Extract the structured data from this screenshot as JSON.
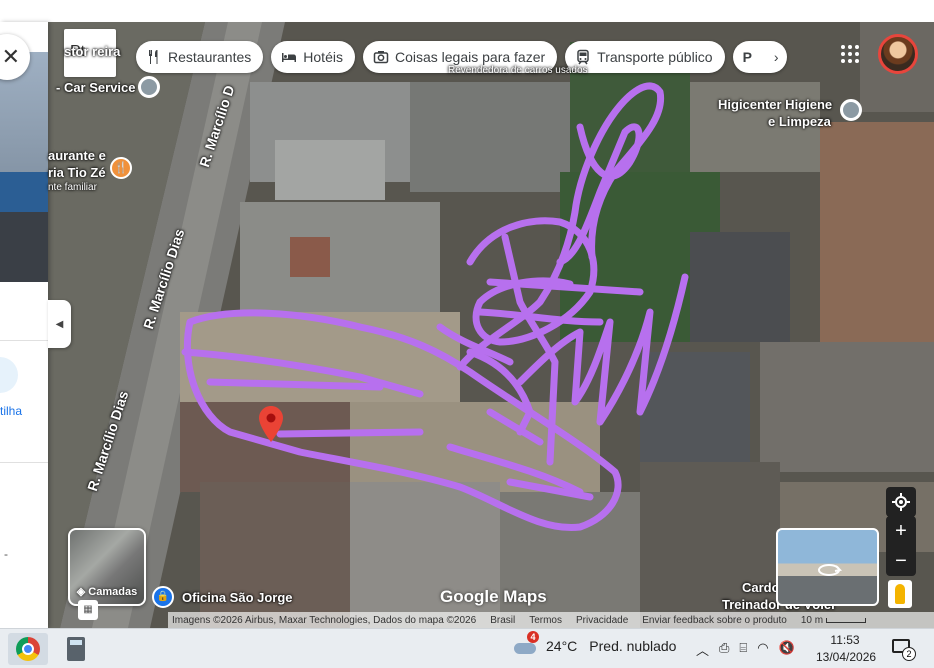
{
  "search": {
    "value": "Pt"
  },
  "chips": [
    {
      "label": "Restaurantes",
      "icon": "fork-knife-icon"
    },
    {
      "label": "Hotéis",
      "icon": "bed-icon"
    },
    {
      "label": "Coisas legais para fazer",
      "icon": "camera-icon"
    },
    {
      "label": "Transporte público",
      "icon": "train-icon"
    },
    {
      "label": "P",
      "icon": "chevron-right-icon"
    }
  ],
  "left_panel": {
    "share_label": "tilha",
    "dash": "-"
  },
  "map_labels": {
    "top_store": "stor   reira",
    "top_sub": "Revendedora de carros usados",
    "car_service": "- Car Service",
    "restaurant_line1": "aurante e",
    "restaurant_line2": "ria Tio Zé",
    "restaurant_line3": "nte familiar",
    "higicenter_line1": "Higicenter Higiene",
    "higicenter_line2": "e Limpeza",
    "street1": "R. Marcílio D",
    "street2": "R. Marcílio Dias",
    "street3": "R. Marcílio Dias",
    "oficina": "Oficina São Jorge",
    "cardo_line1": "Cardo",
    "cardo_line2": "Treinador de Vôlei"
  },
  "layers": {
    "label": "Camadas"
  },
  "branding": {
    "logo": "Google Maps"
  },
  "attribution": {
    "imagery": "Imagens ©2026 Airbus, Maxar Technologies, Dados do mapa ©2026",
    "country": "Brasil",
    "terms": "Termos",
    "privacy": "Privacidade",
    "feedback": "Enviar feedback sobre o produto",
    "scale": "10 m"
  },
  "taskbar": {
    "weather_badge": "4",
    "temperature": "24°C",
    "weather_text": "Pred. nublado",
    "time": "11:53",
    "date": "13/04/2026",
    "notif_count": "2"
  },
  "colors": {
    "drawing_purple": "#b770ee",
    "pin_red": "#ea4335",
    "poi_orange": "#f0913b",
    "link_blue": "#1a73e8"
  }
}
